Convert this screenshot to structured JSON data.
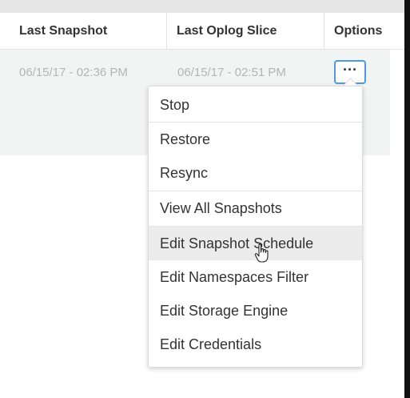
{
  "table": {
    "headers": [
      "Last Snapshot",
      "Last Oplog Slice",
      "Options"
    ],
    "row": {
      "last_snapshot": "06/15/17 - 02:36 PM",
      "last_oplog_slice": "06/15/17 - 02:51 PM",
      "options_glyph": "···"
    }
  },
  "menu": {
    "items": [
      {
        "label": "Stop"
      },
      {
        "label": "Restore"
      },
      {
        "label": "Resync"
      },
      {
        "label": "View All Snapshots"
      },
      {
        "label": "Edit Snapshot Schedule"
      },
      {
        "label": "Edit Namespaces Filter"
      },
      {
        "label": "Edit Storage Engine"
      },
      {
        "label": "Edit Credentials"
      }
    ],
    "hovered_item": "Edit Snapshot Schedule"
  },
  "colors": {
    "button_focus_border": "#4a9be0",
    "row_background": "#f2f3f3",
    "hover_background": "#ececec"
  },
  "icons": {
    "pointer": "hand-pointer-icon",
    "options": "ellipsis-icon"
  }
}
